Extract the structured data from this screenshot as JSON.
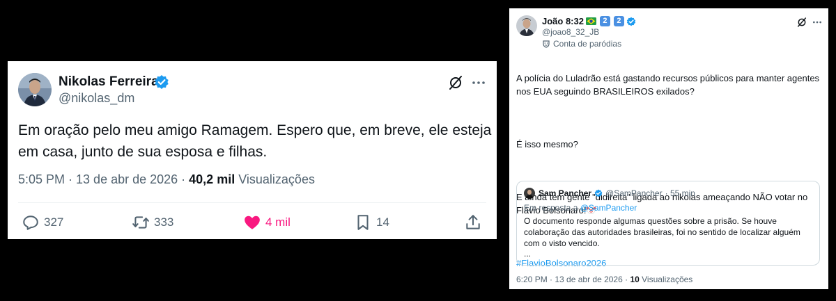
{
  "left_tweet": {
    "author_name": "Nikolas Ferreira",
    "author_handle": "@nikolas_dm",
    "text": "Em oração pelo meu amigo Ramagem. Espero que, em breve, ele esteja em casa, junto de sua esposa e filhas.",
    "time": "5:05 PM · 13 de abr de 2026 · ",
    "views_count": "40,2 mil",
    "views_label": "Visualizações",
    "replies": "327",
    "retweets": "333",
    "likes": "4 mil",
    "bookmarks": "14",
    "icons": [
      "verified-badge-icon",
      "grok-icon",
      "more-icon",
      "reply-icon",
      "retweet-icon",
      "heart-icon",
      "bookmark-icon",
      "share-icon"
    ],
    "like_color": "#f91880",
    "verified_color": "#1d9bf0"
  },
  "right_tweet": {
    "author_name": "João 8:32",
    "badge_1": "2",
    "badge_2": "2",
    "author_handle": "@joao8_32_JB",
    "parody_label": "Conta de paródias",
    "text_p1": "A polícia do Luladrão está gastando recursos públicos para manter agentes nos EUA seguindo BRASILEIROS exilados?",
    "text_p2": "É isso mesmo?",
    "text_p3": "E ainda tem gente \"didireita\" ligada ao nikolas ameaçando NÃO votar no Flávio Bolsonaro!",
    "hashtag": "#FlavioBolsonaro2026",
    "time": "6:20 PM · 13 de abr de 2026 · ",
    "views_count": "10",
    "views_label": "Visualizações",
    "quote": {
      "author_name": "Sam Pancher",
      "author_handle": "@SamPancher",
      "time": "· 55 min",
      "reply_prefix": "Em resposta a ",
      "reply_handle": "@SamPancher",
      "text": "O documento responde algumas questões sobre a prisão. Se houve colaboração das autoridades brasileiras, foi no sentido de localizar alguém com o visto vencido.",
      "ellipsis": "..."
    },
    "icons": [
      "brazil-flag-icon",
      "verified-badge-icon",
      "grok-icon",
      "more-icon",
      "parody-mask-icon",
      "clown-emoji-icon"
    ]
  }
}
